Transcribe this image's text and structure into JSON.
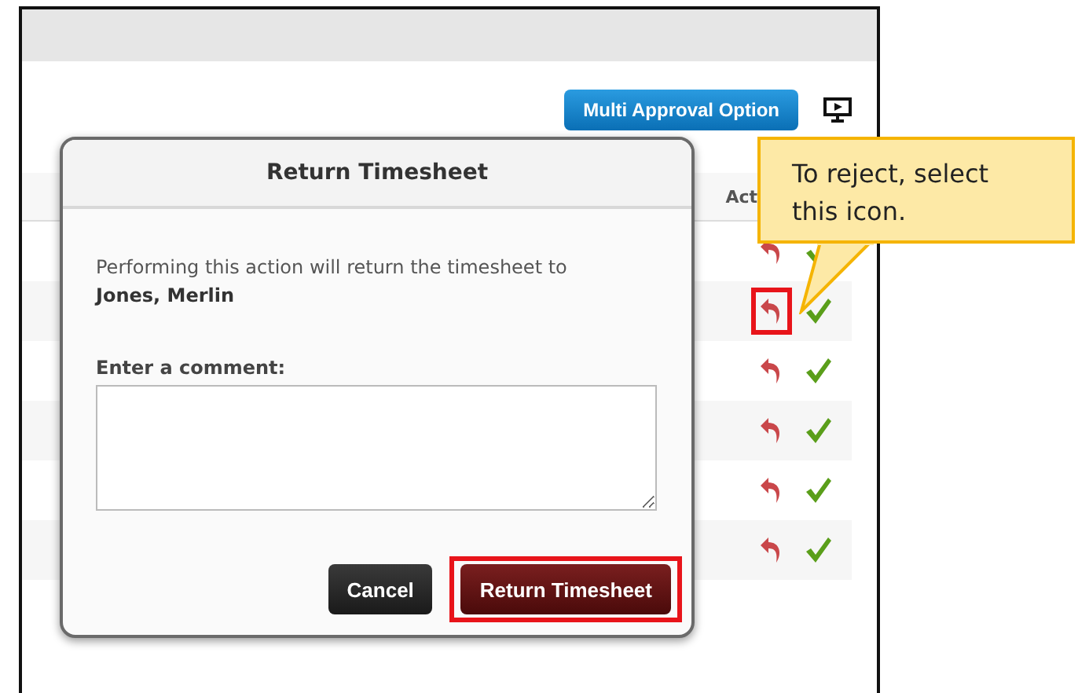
{
  "toolbar": {
    "multi_approval_button": "Multi Approval Option"
  },
  "table": {
    "action_header": "Act",
    "rows": [
      {
        "highlighted": false
      },
      {
        "highlighted": true
      },
      {
        "highlighted": false
      },
      {
        "highlighted": false
      },
      {
        "highlighted": false
      },
      {
        "highlighted": false
      }
    ]
  },
  "dialog": {
    "title": "Return Timesheet",
    "message": "Performing this action will return the timesheet to",
    "employee": "Jones, Merlin",
    "comment_label": "Enter a comment:",
    "buttons": [
      {
        "label": "Cancel",
        "kind": "cancel",
        "highlighted": false
      },
      {
        "label": "Return Timesheet",
        "kind": "confirm",
        "highlighted": true
      }
    ]
  },
  "callout": {
    "text": "To reject, select this icon."
  }
}
